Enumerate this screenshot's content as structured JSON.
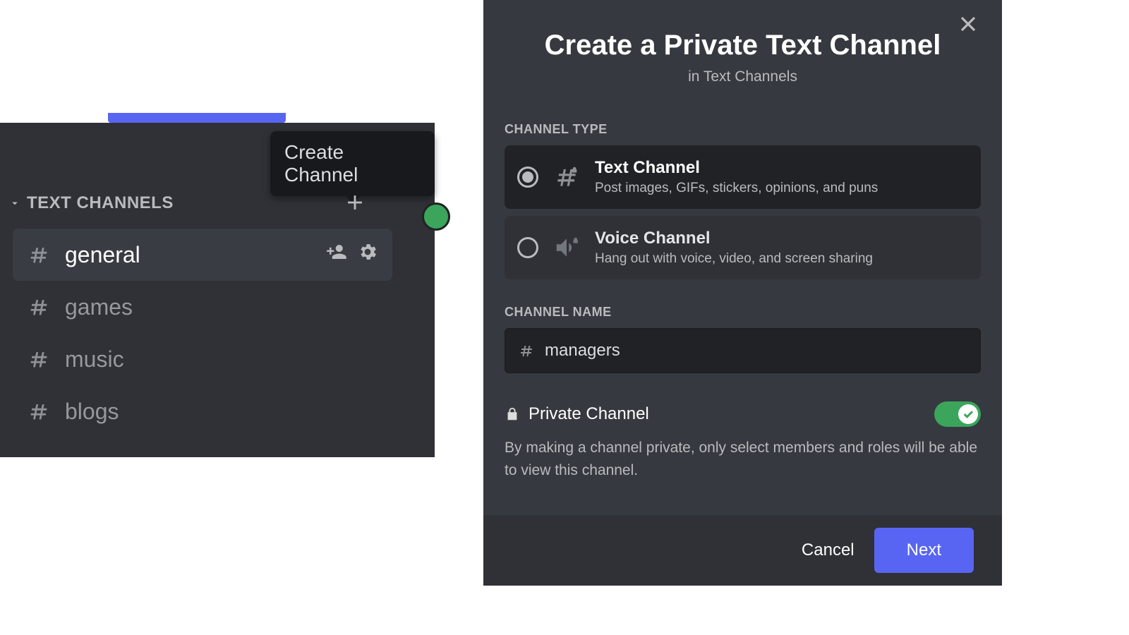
{
  "sidebar": {
    "category_label": "TEXT CHANNELS",
    "tooltip": "Create Channel",
    "channels": [
      {
        "name": "general",
        "selected": true
      },
      {
        "name": "games",
        "selected": false
      },
      {
        "name": "music",
        "selected": false
      },
      {
        "name": "blogs",
        "selected": false
      }
    ]
  },
  "modal": {
    "title": "Create a Private Text Channel",
    "subtitle": "in Text Channels",
    "section_type": "CHANNEL TYPE",
    "types": [
      {
        "title": "Text Channel",
        "desc": "Post images, GIFs, stickers, opinions, and puns",
        "selected": true
      },
      {
        "title": "Voice Channel",
        "desc": "Hang out with voice, video, and screen sharing",
        "selected": false
      }
    ],
    "section_name": "CHANNEL NAME",
    "name_value": "managers",
    "private_label": "Private Channel",
    "private_on": true,
    "private_desc": "By making a channel private, only select members and roles will be able to view this channel.",
    "cancel": "Cancel",
    "next": "Next"
  }
}
